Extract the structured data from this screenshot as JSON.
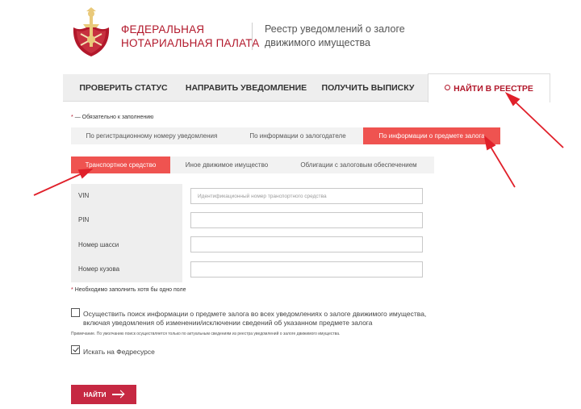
{
  "header": {
    "org_line1": "ФЕДЕРАЛЬНАЯ",
    "org_line2": "НОТАРИАЛЬНАЯ ПАЛАТА",
    "registry_line1": "Реестр уведомлений о залоге",
    "registry_line2": "движимого имущества"
  },
  "nav": {
    "check_status": "ПРОВЕРИТЬ СТАТУС",
    "send_notice": "НАПРАВИТЬ УВЕДОМЛЕНИЕ",
    "get_extract": "ПОЛУЧИТЬ ВЫПИСКУ",
    "find_in_registry": "НАЙТИ В РЕЕСТРЕ"
  },
  "required_note": "— Обязательно к заполнению",
  "search_tabs": {
    "by_reg_number": "По регистрационному номеру уведомления",
    "by_pledgor": "По информации о залогодателе",
    "by_subject": "По информации о предмете залога"
  },
  "category_tabs": {
    "vehicle": "Транспортное средство",
    "other": "Иное движимое имущество",
    "bonds": "Облигации с залоговым обеспечением"
  },
  "form": {
    "vin_label": "VIN",
    "vin_placeholder": "Идентификационный номер транспортного средства",
    "pin_label": "PIN",
    "chassis_label": "Номер шасси",
    "body_label": "Номер кузова"
  },
  "at_least_one": "Необходимо заполнить хотя бы одно поле",
  "options": {
    "all_notices_line1": "Осуществить поиск информации о предмете залога во всех уведомлениях о залоге движимого имущества,",
    "all_notices_line2": "включая уведомления об изменении/исключении сведений об указанном предмете залога",
    "note": "Примечание. По умолчанию поиск осуществляется только по актуальным сведениям из реестра уведомлений о залоге движимого имущества.",
    "fedresurs": "Искать на Федресурсе",
    "fedresurs_checked": true,
    "all_notices_checked": false
  },
  "submit_label": "НАЙТИ",
  "colors": {
    "brand_red": "#b2182b",
    "active_tab": "#ef5350",
    "button": "#c62842",
    "annotation_arrow": "#e0202a"
  }
}
